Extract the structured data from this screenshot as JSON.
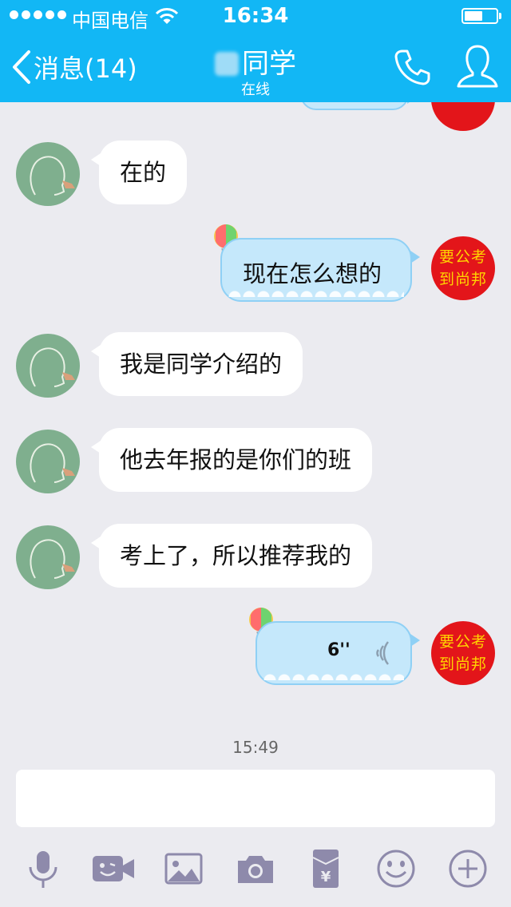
{
  "status_bar": {
    "carrier": "中国电信",
    "time": "16:34"
  },
  "nav": {
    "back_label": "消息(14)",
    "title": "同学",
    "subtitle": "在线"
  },
  "messages": [
    {
      "side": "left",
      "text": "在的"
    },
    {
      "side": "right",
      "text": "现在怎么想的"
    },
    {
      "side": "left",
      "text": "我是同学介绍的"
    },
    {
      "side": "left",
      "text": "他去年报的是你们的班"
    },
    {
      "side": "left",
      "text": "考上了，所以推荐我的"
    },
    {
      "side": "right",
      "type": "voice",
      "duration": "6''"
    }
  ],
  "timestamp": "15:49",
  "avatar_text_right": [
    "要公考",
    "到尚邦"
  ],
  "icons": [
    "back-chevron-icon",
    "phone-icon",
    "profile-icon",
    "microphone-icon",
    "video-call-icon",
    "image-icon",
    "camera-icon",
    "red-packet-icon",
    "emoji-icon",
    "add-icon",
    "voice-wave-icon",
    "balloon-icon"
  ],
  "colors": {
    "nav_bg": "#12b7f5",
    "chat_bg": "#ebebf0",
    "toolbar_icon": "#8e8aab",
    "bubble_right": "#c5e8fb"
  }
}
